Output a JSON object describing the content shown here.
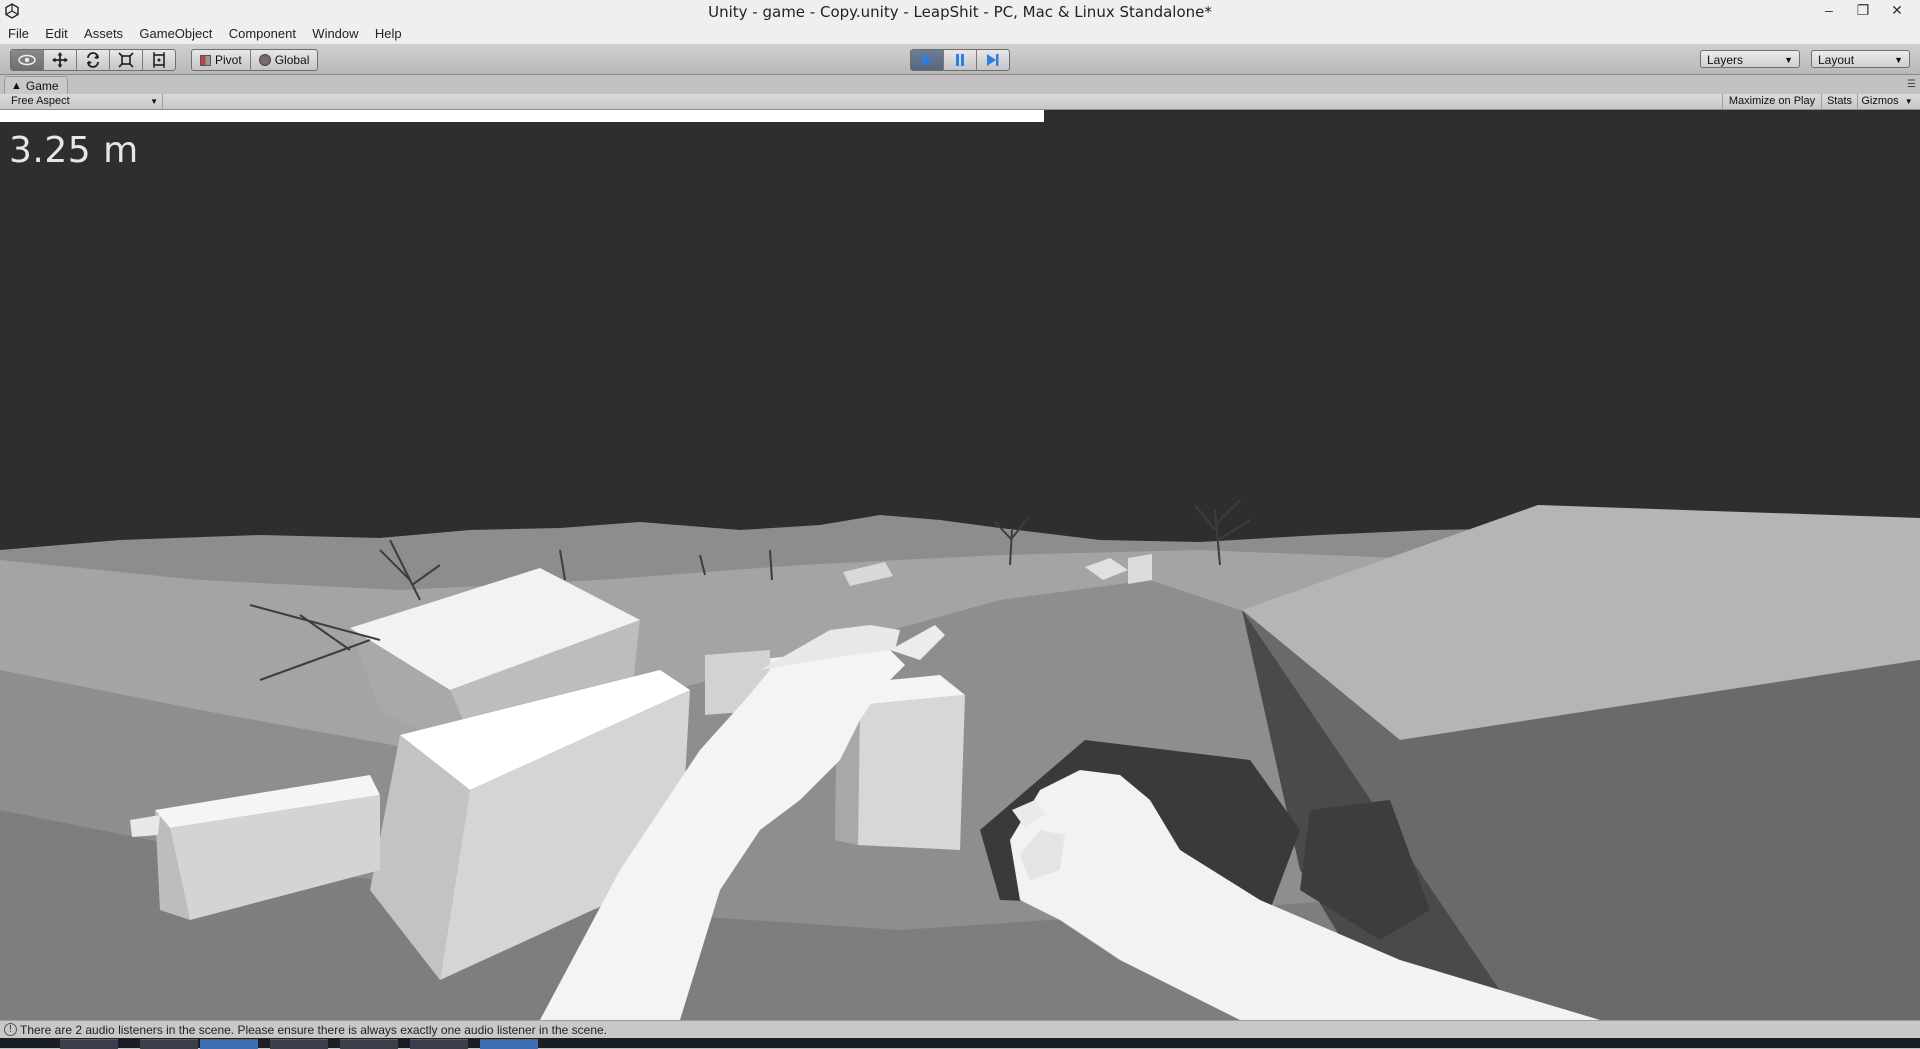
{
  "window": {
    "title": "Unity - game - Copy.unity - LeapShit - PC, Mac & Linux Standalone*",
    "app_icon": "unity-logo-icon",
    "controls": [
      "minimize-icon",
      "restore-icon",
      "close-icon"
    ]
  },
  "menu": {
    "items": [
      "File",
      "Edit",
      "Assets",
      "GameObject",
      "Component",
      "Window",
      "Help"
    ]
  },
  "toolbar": {
    "transform_tools": [
      "hand-eye-icon",
      "move-icon",
      "rotate-icon",
      "scale-icon",
      "rect-icon"
    ],
    "pivot_label": "Pivot",
    "global_label": "Global",
    "play_controls": [
      "play-icon",
      "pause-icon",
      "step-icon"
    ],
    "layers_label": "Layers",
    "layout_label": "Layout"
  },
  "game_view": {
    "tab_label": "Game",
    "aspect_label": "Free Aspect",
    "maximize_label": "Maximize on Play",
    "stats_label": "Stats",
    "gizmos_label": "Gizmos",
    "progress": 0.544,
    "distance_text": "3.25 m"
  },
  "status": {
    "message": "There are 2 audio listeners in the scene. Please ensure there is always exactly one audio listener in the scene."
  },
  "colors": {
    "sky": "#2e2e2e",
    "play_active": "#5a6a82",
    "hud_text": "#e6e6e6"
  }
}
